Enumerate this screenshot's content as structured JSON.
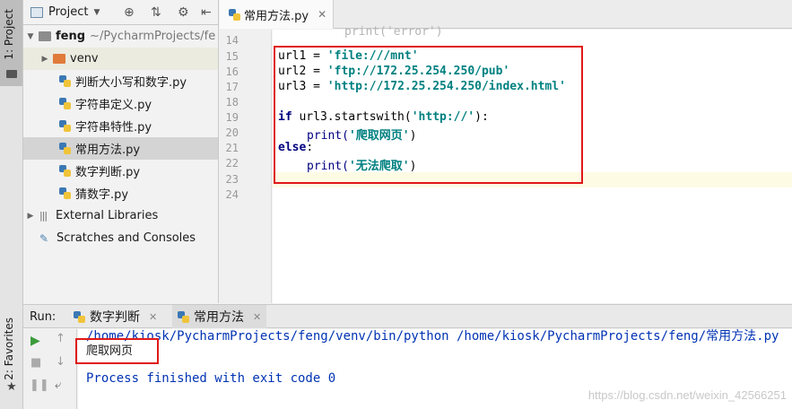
{
  "tool_stripe": {
    "project_tab": "1: Project",
    "favorites_tab": "2: Favorites"
  },
  "project_panel": {
    "title": "Project",
    "tree": [
      {
        "label": "feng",
        "hint": "~/PycharmProjects/fe",
        "type": "root",
        "icon": "folder-icon"
      },
      {
        "label": "venv",
        "type": "folder",
        "icon": "folder-icon"
      },
      {
        "label": "判断大小写和数字.py",
        "type": "file",
        "icon": "python-file-icon"
      },
      {
        "label": "字符串定义.py",
        "type": "file",
        "icon": "python-file-icon"
      },
      {
        "label": "字符串特性.py",
        "type": "file",
        "icon": "python-file-icon"
      },
      {
        "label": "常用方法.py",
        "type": "file",
        "icon": "python-file-icon",
        "selected": true
      },
      {
        "label": "数字判断.py",
        "type": "file",
        "icon": "python-file-icon"
      },
      {
        "label": "猜数字.py",
        "type": "file",
        "icon": "python-file-icon"
      },
      {
        "label": "External Libraries",
        "type": "libs",
        "icon": "library-icon"
      },
      {
        "label": "Scratches and Consoles",
        "type": "scratches",
        "icon": "scratches-icon"
      }
    ]
  },
  "editor": {
    "tab_label": "常用方法.py",
    "line_numbers": [
      "14",
      "15",
      "16",
      "17",
      "18",
      "19",
      "20",
      "21",
      "22",
      "23",
      "24"
    ],
    "code": {
      "l14": "print('error')",
      "l15_var": "url1 = ",
      "l15_str": "'file:///mnt'",
      "l16_var": "url2 = ",
      "l16_str": "'ftp://172.25.254.250/pub'",
      "l17_var": "url3 = ",
      "l17_str": "'http://172.25.254.250/index.html'",
      "l19_kw": "if",
      "l19_mid": " url3.startswith(",
      "l19_str": "'http://'",
      "l19_end": "):",
      "l20_fn": "print(",
      "l20_str": "'爬取网页'",
      "l20_end": ")",
      "l21_kw": "else",
      "l21_end": ":",
      "l22_fn": "print(",
      "l22_str": "'无法爬取'",
      "l22_end": ")"
    }
  },
  "run": {
    "label": "Run:",
    "tabs": [
      {
        "label": "数字判断"
      },
      {
        "label": "常用方法",
        "active": true
      }
    ],
    "output": [
      "/home/kiosk/PycharmProjects/feng/venv/bin/python /home/kiosk/PycharmProjects/feng/常用方法.py",
      "爬取网页",
      "",
      "Process finished with exit code 0"
    ],
    "watermark": "https://blog.csdn.net/weixin_42566251"
  },
  "colors": {
    "keyword": "#000080",
    "string": "#008080",
    "highlight_box": "#e01818",
    "selected_row": "#d4d4d4"
  }
}
